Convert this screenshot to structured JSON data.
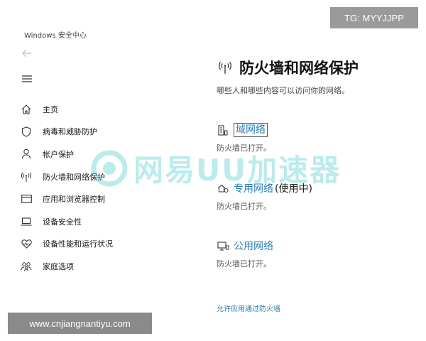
{
  "app": {
    "title": "Windows 安全中心"
  },
  "sidebar": {
    "items": [
      {
        "label": "主页",
        "icon": "home-icon"
      },
      {
        "label": "病毒和威胁防护",
        "icon": "shield-icon"
      },
      {
        "label": "帐户保护",
        "icon": "person-icon"
      },
      {
        "label": "防火墙和网络保护",
        "icon": "antenna-icon"
      },
      {
        "label": "应用和浏览器控制",
        "icon": "app-window-icon"
      },
      {
        "label": "设备安全性",
        "icon": "laptop-icon"
      },
      {
        "label": "设备性能和运行状况",
        "icon": "heart-icon"
      },
      {
        "label": "家庭选项",
        "icon": "family-icon"
      }
    ]
  },
  "main": {
    "title": "防火墙和网络保护",
    "subtitle": "哪些人和哪些内容可以访问你的网络。",
    "networks": [
      {
        "label": "域网络",
        "suffix": "",
        "status": "防火墙已打开。",
        "icon": "domain-building-icon"
      },
      {
        "label": "专用网络",
        "suffix": "(使用中)",
        "status": "防火墙已打开。",
        "icon": "private-network-icon"
      },
      {
        "label": "公用网络",
        "suffix": "",
        "status": "防火墙已打开。",
        "icon": "public-network-icon"
      }
    ],
    "allow_link": "允许应用通过防火墙"
  },
  "watermark": {
    "text": "网易UU加速器"
  },
  "overlays": {
    "tg": "TG: MYYJJPP",
    "url": "www.cnjiangnantiyu.com"
  },
  "colors": {
    "link": "#2a7fb5",
    "watermark": "#33c2c4"
  }
}
